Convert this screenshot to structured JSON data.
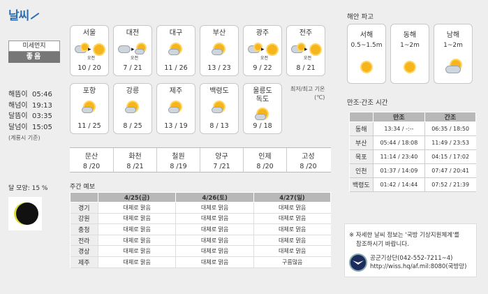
{
  "title": "날씨",
  "dust": {
    "label": "미세먼지",
    "value": "좋음"
  },
  "sun": [
    {
      "label": "해뜸이",
      "time": "05:46"
    },
    {
      "label": "해넘이",
      "time": "19:13"
    },
    {
      "label": "달뜸이",
      "time": "03:35"
    },
    {
      "label": "달넘이",
      "time": "15:05"
    }
  ],
  "sun_note": "(계룡시 기준)",
  "moon": {
    "label": "달 모양: 15 %",
    "phase_percent": 15
  },
  "cities": [
    {
      "name": "서울",
      "temp": "10 / 20",
      "icon": "partly-cloudy-then-sunny",
      "am": "오전"
    },
    {
      "name": "대전",
      "temp": "7 / 21",
      "icon": "cloudy-then-partly-cloudy",
      "am": "오전"
    },
    {
      "name": "대구",
      "temp": "11 / 26",
      "icon": "partly-cloudy"
    },
    {
      "name": "부산",
      "temp": "13 / 23",
      "icon": "partly-cloudy"
    },
    {
      "name": "광주",
      "temp": "9 / 22",
      "icon": "partly-cloudy-then-sunny",
      "am": "오전"
    },
    {
      "name": "전주",
      "temp": "8 / 21",
      "icon": "partly-cloudy-then-sunny",
      "am": "오전"
    },
    {
      "name": "포항",
      "temp": "11 / 25",
      "icon": "partly-cloudy"
    },
    {
      "name": "강릉",
      "temp": "8 / 25",
      "icon": "partly-cloudy"
    },
    {
      "name": "제주",
      "temp": "13 / 19",
      "icon": "partly-cloudy"
    },
    {
      "name": "백령도",
      "temp": "8 / 13",
      "icon": "partly-cloudy"
    },
    {
      "name": "울릉도\n독도",
      "name1": "울릉도",
      "name2": "독도",
      "temp": "9 / 18",
      "icon": "partly-cloudy"
    }
  ],
  "legend_note": {
    "line1": "최저/최고 기온",
    "line2": "(℃)"
  },
  "precip_cities": [
    {
      "name": "문산",
      "value": "8 /20"
    },
    {
      "name": "화천",
      "value": "8 /21"
    },
    {
      "name": "철원",
      "value": "8 /19"
    },
    {
      "name": "양구",
      "value": "7 /21"
    },
    {
      "name": "인제",
      "value": "8 /20"
    },
    {
      "name": "고성",
      "value": "8 /20"
    }
  ],
  "weekly": {
    "title": "주간 예보",
    "headers": [
      "",
      "4/25(금)",
      "4/26(토)",
      "4/27(일)"
    ],
    "rows": [
      {
        "region": "경기",
        "d1": "대체로 맑음",
        "d2": "대체로 맑음",
        "d3": "대체로 맑음"
      },
      {
        "region": "강원",
        "d1": "대체로 맑음",
        "d2": "대체로 맑음",
        "d3": "대체로 맑음"
      },
      {
        "region": "충청",
        "d1": "대체로 맑음",
        "d2": "대체로 맑음",
        "d3": "대체로 맑음"
      },
      {
        "region": "전라",
        "d1": "대체로 맑음",
        "d2": "대체로 맑음",
        "d3": "대체로 맑음"
      },
      {
        "region": "경상",
        "d1": "대체로 맑음",
        "d2": "대체로 맑음",
        "d3": "대체로 맑음"
      },
      {
        "region": "제주",
        "d1": "대체로 맑음",
        "d2": "대체로 맑음",
        "d3": "구름많음"
      }
    ]
  },
  "coast": {
    "title": "해안 파고",
    "seas": [
      {
        "name": "서해",
        "wave": "0.5~1.5m",
        "icon": "sunny"
      },
      {
        "name": "동해",
        "wave": "1~2m",
        "icon": "sunny"
      },
      {
        "name": "남해",
        "wave": "1~2m",
        "icon": "partly-cloudy"
      }
    ]
  },
  "tide": {
    "title": "만조·간조 시간",
    "headers": [
      "",
      "만조",
      "간조"
    ],
    "rows": [
      {
        "region": "동해",
        "high": "13:34 / -:--",
        "low": "06:35 / 18:50"
      },
      {
        "region": "부산",
        "high": "05:44 / 18:08",
        "low": "11:49 / 23:53"
      },
      {
        "region": "목포",
        "high": "11:14 / 23:40",
        "low": "04:15 / 17:02"
      },
      {
        "region": "인천",
        "high": "01:37 / 14:09",
        "low": "07:47 / 20:41"
      },
      {
        "region": "백령도",
        "high": "01:42 / 14:44",
        "low": "07:52 / 21:39"
      }
    ]
  },
  "info": {
    "line1": "※ 자세한 날씨 정보는 '국방 기상지원체계'를",
    "line2": "참조하시기 바랍니다.",
    "org": "공군기상단(042-552-7211~4)",
    "url": "http://wiss.hq/af.mil:8080(국방망)"
  }
}
